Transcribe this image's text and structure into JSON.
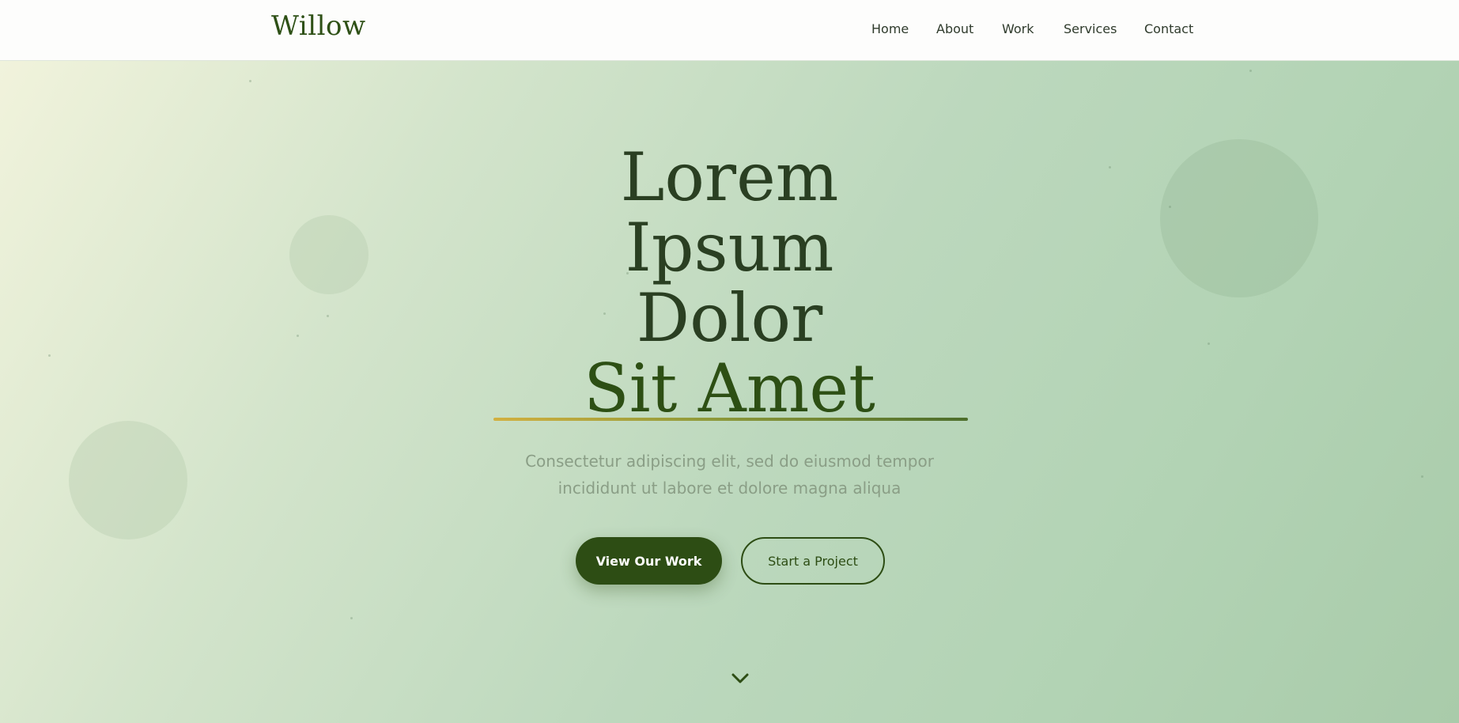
{
  "brand": {
    "logo": "Willow"
  },
  "nav": {
    "items": [
      {
        "label": "Home"
      },
      {
        "label": "About"
      },
      {
        "label": "Work"
      },
      {
        "label": "Services"
      },
      {
        "label": "Contact"
      }
    ]
  },
  "hero": {
    "title_lines": [
      "Lorem",
      "Ipsum",
      "Dolor"
    ],
    "title_accent": "Sit Amet",
    "subtitle_lines": [
      "Consectetur adipiscing elit, sed do eiusmod tempor",
      "incididunt ut labore et dolore magna aliqua"
    ],
    "primary_button": "View Our Work",
    "secondary_button": "Start a Project"
  },
  "icons": {
    "scroll": "chevron-down-icon"
  },
  "colors": {
    "brand": "#2d4d14",
    "title": "#2a3f22",
    "subtitle": "#8a9e86",
    "underline_start": "#d2b040",
    "underline_end": "#4d6e2c",
    "header_bg": "#fdfdfc"
  }
}
